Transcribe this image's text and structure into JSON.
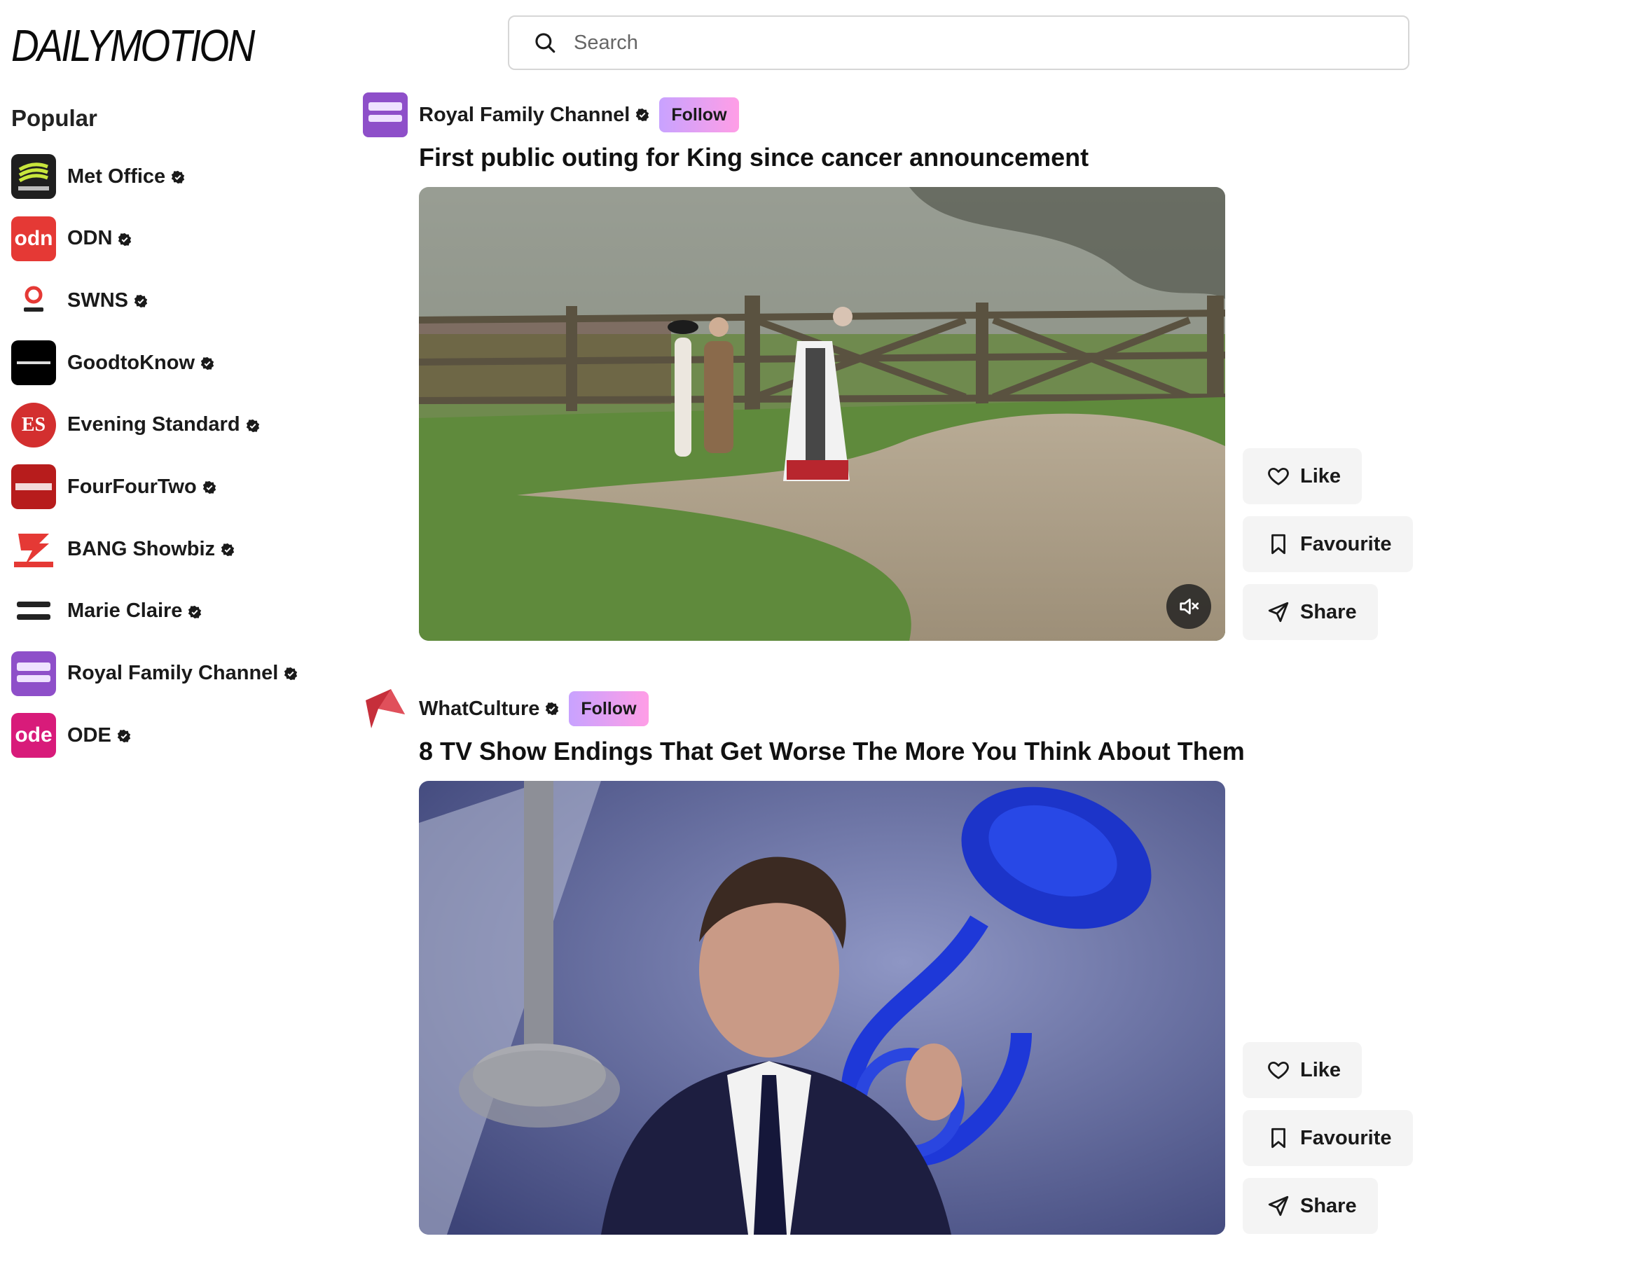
{
  "brand": {
    "logo_text": "DAILYMOTION"
  },
  "search": {
    "placeholder": "Search"
  },
  "sidebar": {
    "title": "Popular",
    "items": [
      {
        "label": "Met Office"
      },
      {
        "label": "ODN"
      },
      {
        "label": "SWNS"
      },
      {
        "label": "GoodtoKnow"
      },
      {
        "label": "Evening Standard"
      },
      {
        "label": "FourFourTwo"
      },
      {
        "label": "BANG Showbiz"
      },
      {
        "label": "Marie Claire"
      },
      {
        "label": "Royal Family Channel"
      },
      {
        "label": "ODE"
      }
    ]
  },
  "feed": [
    {
      "channel": "Royal Family Channel",
      "follow_label": "Follow",
      "title": "First public outing for King since cancer announcement",
      "actions": {
        "like": "Like",
        "favourite": "Favourite",
        "share": "Share"
      }
    },
    {
      "channel": "WhatCulture",
      "follow_label": "Follow",
      "title": "8 TV Show Endings That Get Worse The More You Think About Them",
      "actions": {
        "like": "Like",
        "favourite": "Favourite",
        "share": "Share"
      }
    }
  ],
  "colors": {
    "follow_gradient_start": "#c8a2ff",
    "follow_gradient_end": "#ff9ee6",
    "action_bg": "#f4f4f4"
  }
}
